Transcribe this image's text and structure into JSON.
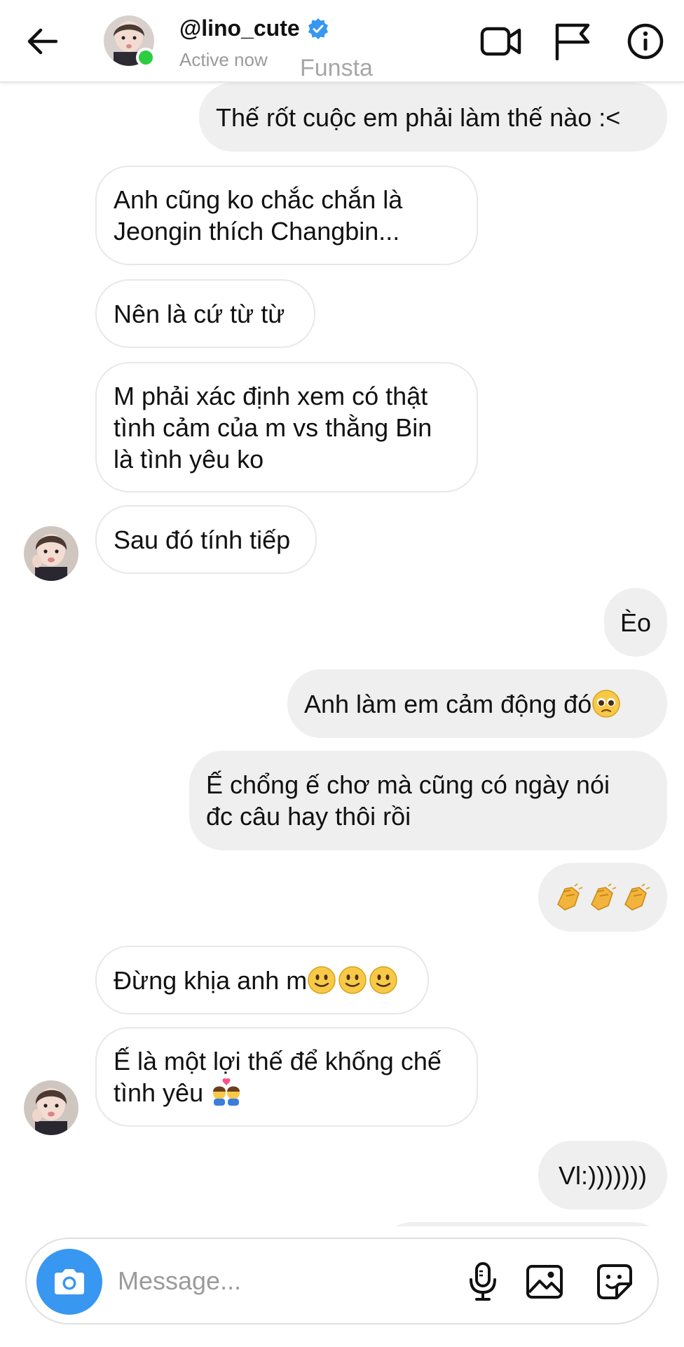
{
  "header": {
    "username": "@lino_cute",
    "status": "Active now",
    "overlay_text": "Funsta"
  },
  "messages": [
    {
      "sender": "me",
      "text": "Thế rốt cuộc em phải làm thế nào :<"
    },
    {
      "sender": "them",
      "text": "Anh cũng ko chắc chắn là\nJeongin thích Changbin..."
    },
    {
      "sender": "them",
      "text": "Nên là cứ từ từ"
    },
    {
      "sender": "them",
      "text": "M phải xác định xem có thật\ntình cảm của m vs thằng Bin\nlà tình yêu ko"
    },
    {
      "sender": "them",
      "text": "Sau đó tính tiếp"
    },
    {
      "sender": "me",
      "text": "Èo"
    },
    {
      "sender": "me",
      "text": "Anh làm em cảm động đó",
      "emoji": "pleading-face"
    },
    {
      "sender": "me",
      "text": "Ế chổng ế chơ mà cũng có ngày nói\nđc câu hay thôi rồi"
    },
    {
      "sender": "me",
      "text": "",
      "emoji": "clapping-hands-x3"
    },
    {
      "sender": "them",
      "text": "Đừng khịa anh m",
      "emoji": "slightly-smiling-face-x3"
    },
    {
      "sender": "them",
      "text": "Ế là một lợi thế để khống chế\ntình yêu",
      "emoji": "couple-kiss"
    },
    {
      "sender": "me",
      "text": "Vl:)))))))"
    }
  ],
  "composer": {
    "placeholder": "Message..."
  },
  "colors": {
    "accent": "#3897f0",
    "online": "#2ecc40",
    "me_bubble": "#efefef",
    "them_border": "#e8e8e8"
  },
  "icons": [
    "back-arrow-icon",
    "verified-badge-icon",
    "video-call-icon",
    "flag-icon",
    "info-icon",
    "camera-icon",
    "microphone-icon",
    "gallery-icon",
    "sticker-icon"
  ]
}
